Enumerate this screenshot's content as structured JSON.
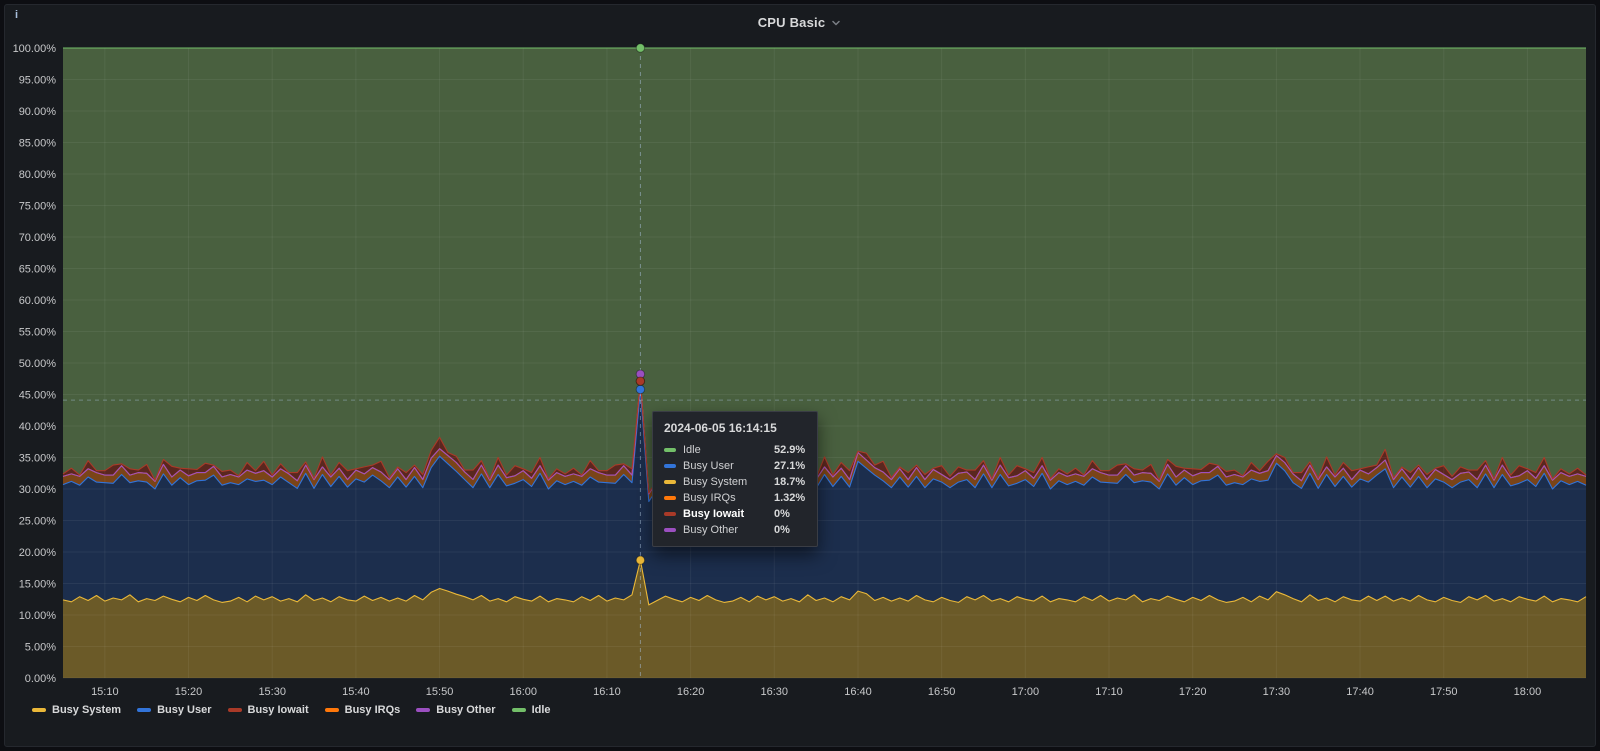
{
  "panel": {
    "title": "CPU Basic",
    "info_icon": "i"
  },
  "tooltip": {
    "timestamp": "2024-06-05 16:14:15",
    "rows": [
      {
        "label": "Idle",
        "value": "52.9%",
        "color": "#73BF69",
        "bold": false
      },
      {
        "label": "Busy User",
        "value": "27.1%",
        "color": "#3274D9",
        "bold": false
      },
      {
        "label": "Busy System",
        "value": "18.7%",
        "color": "#EAB839",
        "bold": false
      },
      {
        "label": "Busy IRQs",
        "value": "1.32%",
        "color": "#FF780A",
        "bold": false
      },
      {
        "label": "Busy Iowait",
        "value": "0%",
        "color": "#A93A28",
        "bold": true
      },
      {
        "label": "Busy Other",
        "value": "0%",
        "color": "#9B4FC0",
        "bold": false
      }
    ]
  },
  "legend": {
    "items": [
      {
        "label": "Busy System",
        "color": "#EAB839"
      },
      {
        "label": "Busy User",
        "color": "#3274D9"
      },
      {
        "label": "Busy Iowait",
        "color": "#A93A28"
      },
      {
        "label": "Busy IRQs",
        "color": "#FF780A"
      },
      {
        "label": "Busy Other",
        "color": "#9B4FC0"
      },
      {
        "label": "Idle",
        "color": "#73BF69"
      }
    ]
  },
  "chart_data": {
    "type": "area",
    "stacked": true,
    "title": "CPU Basic",
    "ylabel": "",
    "xlabel": "",
    "ylim": [
      0,
      100
    ],
    "unit": "percent",
    "grid": true,
    "legend_position": "bottom",
    "time_domain": {
      "start": "15:05",
      "end": "18:07",
      "minutes": 182
    },
    "step_minutes": 1,
    "y_tick_labels": [
      "0.00%",
      "5.00%",
      "10.00%",
      "15.00%",
      "20.00%",
      "25.00%",
      "30.00%",
      "35.00%",
      "40.00%",
      "45.00%",
      "50.00%",
      "55.00%",
      "60.00%",
      "65.00%",
      "70.00%",
      "75.00%",
      "80.00%",
      "85.00%",
      "90.00%",
      "95.00%",
      "100.00%"
    ],
    "y_tick_step": 5,
    "x_ticks": [
      "15:10",
      "15:20",
      "15:30",
      "15:40",
      "15:50",
      "16:00",
      "16:10",
      "16:20",
      "16:30",
      "16:40",
      "16:50",
      "17:00",
      "17:10",
      "17:20",
      "17:30",
      "17:40",
      "17:50",
      "18:00"
    ],
    "x_tick_start_min": 5,
    "x_tick_step_min": 10,
    "crosshair": {
      "snap_index": 69,
      "time": "2024-06-05 16:14:15",
      "pointer_y_percent": 44.1
    },
    "series": [
      {
        "name": "Busy System",
        "color": "#EAB839",
        "fill": "#6b5a28",
        "values": [
          12.4,
          12.1,
          12.9,
          12.3,
          13.1,
          12.2,
          12.7,
          12.4,
          13.2,
          12.1,
          12.6,
          12.3,
          13.0,
          12.5,
          12.1,
          12.8,
          12.3,
          13.1,
          12.4,
          12.0,
          12.2,
          12.8,
          12.1,
          13.0,
          12.4,
          12.9,
          12.2,
          12.6,
          12.1,
          13.2,
          12.3,
          12.7,
          12.1,
          12.9,
          12.4,
          12.2,
          13.0,
          12.3,
          12.8,
          12.2,
          12.7,
          12.2,
          13.1,
          12.4,
          13.6,
          14.2,
          13.8,
          13.3,
          12.9,
          12.4,
          13.1,
          12.2,
          12.6,
          12.1,
          12.9,
          12.5,
          12.2,
          13.0,
          12.1,
          12.6,
          12.4,
          12.1,
          12.9,
          12.3,
          13.1,
          12.2,
          12.7,
          12.4,
          13.2,
          18.7,
          11.6,
          12.3,
          13.0,
          12.5,
          12.1,
          12.8,
          12.3,
          13.1,
          12.4,
          12.0,
          12.2,
          12.8,
          12.1,
          13.0,
          12.4,
          12.9,
          12.2,
          12.6,
          12.1,
          13.2,
          12.3,
          12.7,
          12.1,
          12.9,
          12.4,
          13.8,
          13.4,
          12.3,
          12.8,
          12.2,
          12.7,
          12.2,
          13.1,
          12.4,
          12.1,
          12.8,
          12.3,
          12.0,
          12.9,
          12.4,
          13.1,
          12.2,
          12.6,
          12.1,
          12.9,
          12.5,
          12.2,
          13.0,
          12.1,
          12.6,
          12.4,
          12.1,
          12.9,
          12.3,
          13.1,
          12.2,
          12.7,
          12.4,
          13.2,
          12.1,
          12.6,
          12.3,
          13.0,
          12.5,
          12.1,
          12.8,
          12.3,
          13.1,
          12.4,
          12.0,
          12.2,
          12.8,
          12.1,
          13.0,
          12.4,
          13.7,
          13.2,
          12.6,
          12.1,
          13.2,
          12.3,
          12.7,
          12.1,
          12.9,
          12.4,
          12.2,
          13.0,
          12.3,
          13.0,
          12.2,
          12.7,
          12.2,
          13.1,
          12.4,
          12.1,
          12.8,
          12.3,
          12.0,
          12.9,
          12.4,
          13.1,
          12.2,
          12.6,
          12.1,
          12.9,
          12.5,
          12.2,
          13.0,
          12.1,
          12.6,
          12.4,
          12.1,
          12.9
        ]
      },
      {
        "name": "Busy User",
        "color": "#3274D9",
        "fill": "#1c2e4d",
        "values": [
          18.3,
          19.1,
          17.7,
          19.6,
          18.0,
          18.8,
          18.2,
          19.9,
          17.8,
          19.2,
          18.5,
          17.7,
          19.4,
          18.1,
          19.7,
          17.9,
          19.0,
          18.3,
          19.8,
          18.6,
          18.8,
          17.9,
          19.5,
          18.2,
          19.0,
          17.8,
          19.7,
          18.4,
          18.0,
          19.3,
          17.8,
          19.6,
          18.3,
          19.1,
          17.9,
          19.4,
          18.1,
          19.9,
          18.5,
          18.0,
          19.2,
          18.1,
          18.9,
          17.8,
          19.8,
          21.0,
          20.2,
          19.5,
          18.6,
          17.8,
          19.3,
          18.0,
          19.7,
          18.4,
          18.0,
          19.0,
          18.2,
          19.5,
          17.9,
          18.7,
          18.3,
          19.1,
          17.7,
          19.6,
          18.0,
          18.8,
          18.2,
          19.9,
          17.8,
          27.1,
          16.4,
          17.7,
          19.4,
          18.1,
          19.7,
          17.9,
          19.0,
          18.3,
          19.8,
          18.6,
          18.8,
          17.9,
          19.5,
          18.2,
          19.0,
          17.8,
          19.7,
          18.4,
          18.0,
          19.3,
          17.8,
          19.6,
          18.3,
          19.1,
          17.9,
          20.6,
          19.9,
          19.9,
          18.5,
          18.0,
          19.2,
          18.1,
          18.9,
          17.8,
          19.5,
          18.3,
          17.9,
          19.1,
          18.6,
          17.8,
          19.3,
          18.0,
          19.7,
          18.4,
          18.0,
          19.0,
          18.2,
          19.5,
          17.9,
          18.7,
          18.3,
          19.1,
          17.7,
          19.6,
          18.0,
          18.8,
          18.2,
          19.9,
          17.8,
          19.2,
          18.5,
          17.7,
          19.4,
          18.1,
          19.7,
          17.9,
          19.0,
          18.3,
          19.8,
          18.6,
          18.8,
          17.9,
          19.5,
          18.2,
          19.0,
          20.4,
          19.7,
          18.4,
          18.0,
          19.3,
          17.8,
          19.6,
          18.3,
          19.1,
          17.9,
          19.4,
          18.1,
          19.9,
          20.2,
          18.0,
          19.2,
          18.1,
          18.9,
          17.8,
          19.5,
          18.3,
          17.9,
          19.1,
          18.6,
          17.8,
          19.3,
          18.0,
          19.7,
          18.4,
          18.0,
          19.0,
          18.2,
          19.5,
          17.9,
          18.7,
          18.3,
          19.1,
          17.7
        ]
      },
      {
        "name": "Busy IRQs",
        "color": "#FF780A",
        "fill": "#7a4418",
        "values": [
          1.3,
          1.2,
          1.4,
          1.3,
          1.5,
          1.2,
          1.3,
          1.4,
          1.2,
          1.3,
          1.4,
          1.2,
          1.5,
          1.3,
          1.2,
          1.4,
          1.3,
          1.2,
          1.4,
          1.3,
          1.3,
          1.2,
          1.4,
          1.3,
          1.5,
          1.2,
          1.3,
          1.4,
          1.2,
          1.3,
          1.4,
          1.2,
          1.5,
          1.3,
          1.2,
          1.4,
          1.3,
          1.2,
          1.4,
          1.3,
          1.3,
          1.2,
          1.4,
          1.3,
          1.5,
          1.2,
          1.3,
          1.4,
          1.2,
          1.3,
          1.4,
          1.2,
          1.5,
          1.3,
          1.2,
          1.4,
          1.3,
          1.2,
          1.4,
          1.3,
          1.3,
          1.2,
          1.4,
          1.3,
          1.5,
          1.2,
          1.3,
          1.4,
          1.2,
          1.32,
          1.2,
          1.2,
          1.5,
          1.3,
          1.2,
          1.4,
          1.3,
          1.2,
          1.4,
          1.3,
          1.3,
          1.2,
          1.4,
          1.3,
          1.5,
          1.2,
          1.3,
          1.4,
          1.2,
          1.3,
          1.4,
          1.2,
          1.5,
          1.3,
          1.2,
          1.4,
          1.3,
          1.2,
          1.4,
          1.3,
          1.3,
          1.2,
          1.4,
          1.3,
          1.5,
          1.2,
          1.3,
          1.4,
          1.2,
          1.3,
          1.4,
          1.2,
          1.5,
          1.3,
          1.2,
          1.4,
          1.3,
          1.2,
          1.4,
          1.3,
          1.3,
          1.2,
          1.4,
          1.3,
          1.5,
          1.2,
          1.3,
          1.4,
          1.2,
          1.3,
          1.4,
          1.2,
          1.5,
          1.3,
          1.2,
          1.4,
          1.3,
          1.2,
          1.4,
          1.3,
          1.3,
          1.2,
          1.4,
          1.3,
          1.5,
          1.2,
          1.3,
          1.4,
          1.2,
          1.3,
          1.4,
          1.2,
          1.5,
          1.3,
          1.2,
          1.4,
          1.3,
          1.2,
          1.4,
          1.3,
          1.3,
          1.2,
          1.4,
          1.3,
          1.5,
          1.2,
          1.3,
          1.4,
          1.2,
          1.3,
          1.4,
          1.2,
          1.5,
          1.3,
          1.2,
          1.4,
          1.3,
          1.2,
          1.4,
          1.3,
          1.3,
          1.2,
          1.4
        ]
      },
      {
        "name": "Busy Other",
        "color": "#9B4FC0",
        "fill": null,
        "constant": 0
      },
      {
        "name": "Busy Iowait",
        "color": "#A93A28",
        "fill": "#5a271f",
        "values": [
          0.4,
          0.9,
          0.2,
          1.3,
          0.3,
          0.7,
          1.6,
          0.3,
          1.0,
          0.4,
          1.4,
          0.2,
          0.8,
          1.7,
          0.3,
          1.1,
          0.5,
          1.5,
          0.2,
          0.9,
          0.7,
          0.2,
          1.2,
          0.4,
          1.5,
          0.3,
          0.8,
          0.2,
          1.3,
          0.5,
          0.2,
          1.6,
          0.3,
          0.9,
          1.4,
          0.2,
          1.1,
          0.4,
          1.7,
          0.3,
          0.3,
          1.1,
          0.4,
          0.8,
          1.2,
          1.8,
          0.5,
          1.0,
          0.3,
          1.5,
          0.7,
          0.2,
          1.2,
          0.4,
          1.6,
          0.3,
          0.9,
          1.3,
          0.2,
          0.6,
          0.4,
          0.9,
          0.2,
          1.3,
          0.3,
          0.7,
          1.6,
          0.3,
          1.0,
          0.0,
          0.2,
          0.2,
          0.8,
          1.7,
          0.3,
          1.1,
          0.5,
          1.5,
          0.2,
          0.9,
          0.7,
          0.2,
          1.2,
          0.4,
          1.5,
          0.3,
          0.8,
          0.2,
          1.3,
          0.5,
          0.2,
          1.6,
          0.3,
          0.9,
          1.4,
          0.2,
          1.1,
          0.4,
          1.7,
          0.3,
          0.3,
          1.1,
          0.4,
          0.8,
          0.2,
          1.4,
          0.5,
          1.0,
          0.3,
          1.5,
          0.7,
          0.2,
          1.2,
          0.4,
          1.6,
          0.3,
          0.9,
          1.3,
          0.2,
          0.6,
          0.4,
          0.9,
          0.2,
          1.3,
          0.3,
          0.7,
          1.6,
          0.3,
          1.0,
          0.4,
          1.4,
          0.2,
          0.8,
          1.7,
          0.3,
          1.1,
          0.5,
          1.5,
          0.2,
          0.9,
          0.7,
          0.2,
          1.2,
          0.4,
          1.5,
          0.3,
          0.8,
          0.2,
          1.3,
          0.5,
          0.2,
          1.6,
          0.3,
          0.9,
          1.4,
          0.2,
          1.1,
          0.4,
          1.7,
          0.3,
          0.3,
          1.1,
          0.4,
          0.8,
          0.2,
          1.4,
          0.5,
          1.0,
          0.3,
          1.5,
          0.7,
          0.2,
          1.2,
          0.4,
          1.6,
          0.3,
          0.9,
          1.3,
          0.2,
          0.6,
          0.4,
          0.9,
          0.2
        ]
      },
      {
        "name": "Idle",
        "color": "#73BF69",
        "fill": "#49603f",
        "remainder": true
      }
    ]
  }
}
